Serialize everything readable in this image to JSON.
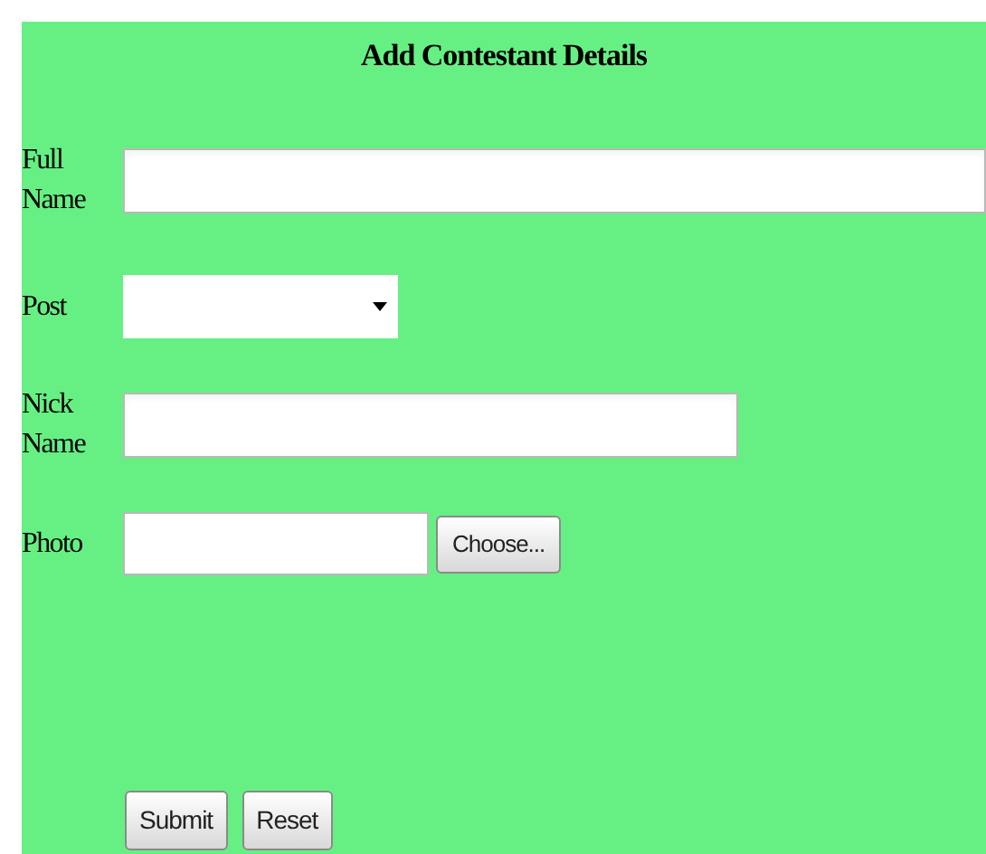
{
  "form": {
    "title": "Add Contestant Details",
    "fields": [
      {
        "label": "Full Name",
        "kind": "text"
      },
      {
        "label": "Post",
        "kind": "select"
      },
      {
        "label": "Nick Name",
        "kind": "text"
      },
      {
        "label": "Photo",
        "kind": "file",
        "button": "Choose..."
      }
    ],
    "buttons": [
      "Submit",
      "Reset"
    ]
  }
}
